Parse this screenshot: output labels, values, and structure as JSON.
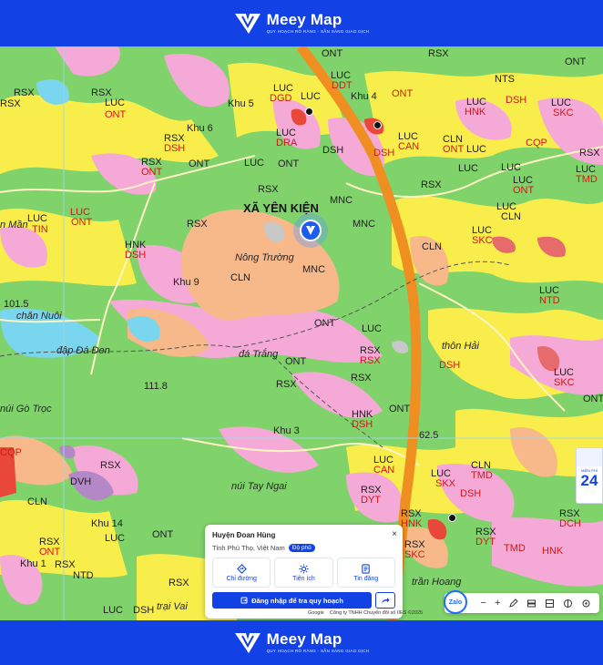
{
  "header": {
    "brand_name": "Meey Map",
    "brand_tagline": "QUY HOẠCH RÕ RÀNG - SẴN SÀNG GIAO DỊCH"
  },
  "footer": {
    "brand_name": "Meey Map",
    "brand_tagline": "QUY HOẠCH RÕ RÀNG - SẴN SÀNG GIAO DỊCH"
  },
  "map": {
    "commune_name": "XÃ YÊN KIỆN",
    "place_labels": [
      "Khu 5",
      "Khu 6",
      "Khu 4",
      "Khu 9",
      "Khu 3",
      "Khu 14",
      "Khu 1",
      "Nông Trường",
      "đá Trắng",
      "thôn Hải",
      "núi Tay Ngai",
      "núi Gò Trọc",
      "chăn Nuôi",
      "đập Đá Đen",
      "trần Hoang",
      "trại Vai",
      "n Mần",
      "101.5",
      "111.8",
      "62.5"
    ],
    "landuse_codes": [
      "RSX",
      "ONT",
      "LUC",
      "CLN",
      "MNC",
      "DSH",
      "HNK",
      "DGD",
      "DDT",
      "NTS",
      "SKC",
      "DRA",
      "CAN",
      "TMD",
      "NTD",
      "DYT",
      "DVH",
      "SKX",
      "TIN",
      "DCH",
      "CQP"
    ]
  },
  "info_panel": {
    "title": "Huyện Đoan Hùng",
    "subtitle": "Tỉnh Phú Thọ, Việt Nam",
    "badge": "Độ phủ",
    "close": "×",
    "actions": [
      {
        "label": "Chỉ đường",
        "icon": "directions-icon"
      },
      {
        "label": "Tiện ích",
        "icon": "utilities-icon"
      },
      {
        "label": "Tin đăng",
        "icon": "listings-icon"
      }
    ],
    "login_label": "Đăng nhập để tra quy hoạch"
  },
  "toolbar": {
    "zalo": "Zalo",
    "zoom_out": "−",
    "zoom_in": "+"
  },
  "credit": "Công ty TNHH Chuyển đổi số IIES ©2025",
  "google_logo": "Google",
  "ad": {
    "caption": "MIỄN PHÍ",
    "number": "24"
  },
  "colors": {
    "brand": "#1242e6",
    "forest": "#7fd36a",
    "rice": "#ffef4a",
    "residential": "#f5a9d6",
    "perennial": "#f7b98a",
    "road": "#f29a2c",
    "water": "#7ad6ee"
  }
}
